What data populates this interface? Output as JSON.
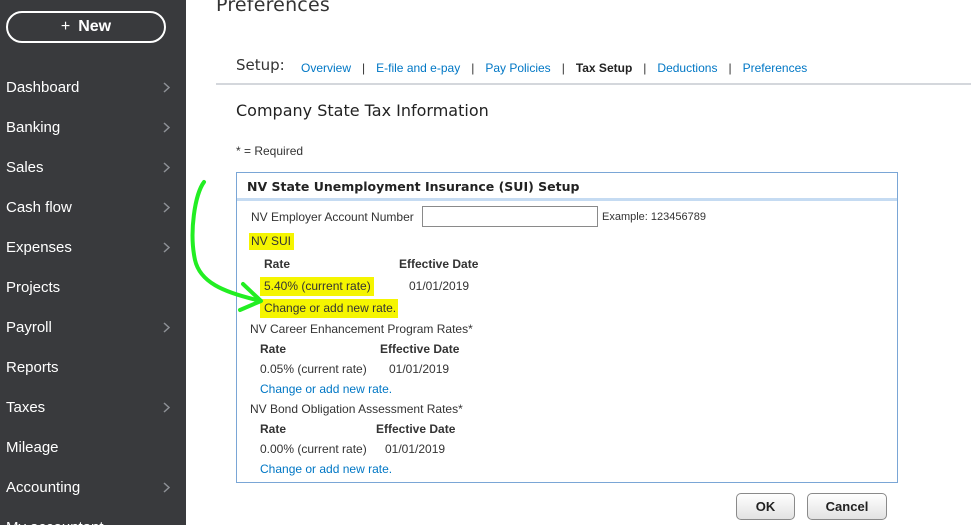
{
  "sidebar": {
    "new_label": "New",
    "items": [
      {
        "label": "Dashboard",
        "chevron": true
      },
      {
        "label": "Banking",
        "chevron": true
      },
      {
        "label": "Sales",
        "chevron": true
      },
      {
        "label": "Cash flow",
        "chevron": true
      },
      {
        "label": "Expenses",
        "chevron": true
      },
      {
        "label": "Projects",
        "chevron": false
      },
      {
        "label": "Payroll",
        "chevron": true
      },
      {
        "label": "Reports",
        "chevron": false
      },
      {
        "label": "Taxes",
        "chevron": true
      },
      {
        "label": "Mileage",
        "chevron": false
      },
      {
        "label": "Accounting",
        "chevron": true
      },
      {
        "label": "My accountant",
        "chevron": false
      }
    ]
  },
  "page": {
    "title": "Preferences",
    "setup_label": "Setup:",
    "setup_links": [
      "Overview",
      "E-file and e-pay",
      "Pay Policies",
      "Tax Setup",
      "Deductions",
      "Preferences"
    ],
    "active_link": "Tax Setup",
    "section_title": "Company State Tax Information",
    "required_note": "* = Required"
  },
  "sui_box": {
    "header": "NV State Unemployment Insurance (SUI) Setup",
    "employer_account_label": "NV Employer Account Number",
    "employer_account_value": "",
    "employer_account_example": "Example: 123456789",
    "sections": [
      {
        "title": "NV SUI",
        "rate_header": "Rate",
        "date_header": "Effective Date",
        "rate": "5.40% (current rate)",
        "date": "01/01/2019",
        "link": "Change or add new rate."
      },
      {
        "title": "NV Career Enhancement Program Rates*",
        "rate_header": "Rate",
        "date_header": "Effective Date",
        "rate": "0.05% (current rate)",
        "date": "01/01/2019",
        "link": "Change or add new rate."
      },
      {
        "title": "NV Bond Obligation Assessment Rates*",
        "rate_header": "Rate",
        "date_header": "Effective Date",
        "rate": "0.00% (current rate)",
        "date": "01/01/2019",
        "link": "Change or add new rate."
      }
    ]
  },
  "buttons": {
    "ok": "OK",
    "cancel": "Cancel"
  },
  "annotation": {
    "highlight_color": "#f5f500",
    "arrow_color": "#22ee22"
  }
}
